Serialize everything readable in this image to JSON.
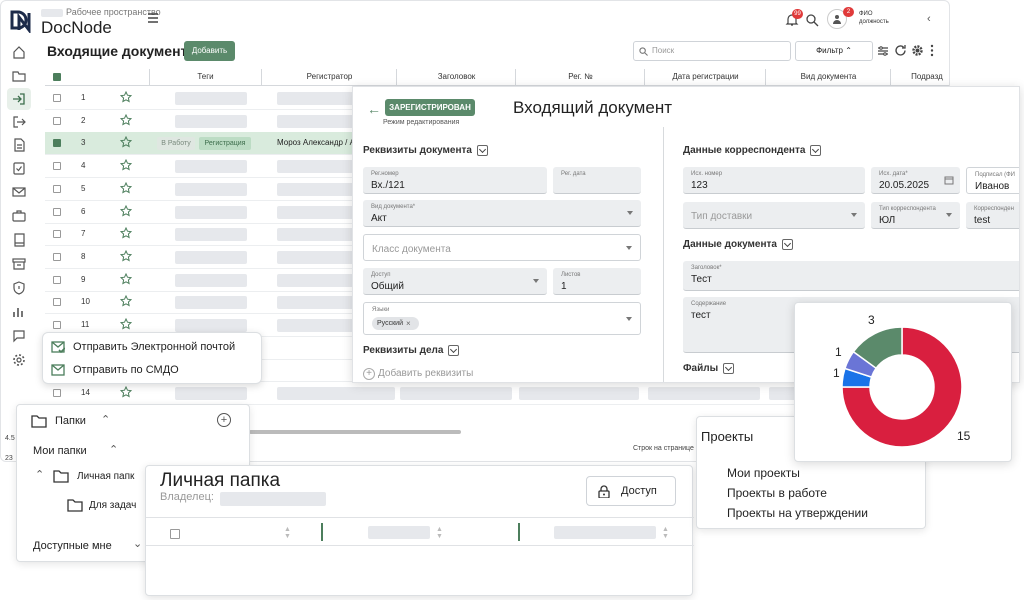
{
  "header": {
    "workspace_label": "Рабочее пространство",
    "brand": "DocNode",
    "bell_count": "99",
    "user_badge": "2",
    "user_name": "ФИО",
    "user_role": "должность"
  },
  "toolbar": {
    "title": "Входящие документы",
    "add_label": "Добавить",
    "search_placeholder": "Поиск",
    "filter_label": "Фильтр"
  },
  "table": {
    "columns": [
      "Теги",
      "Регистратор",
      "Заголовок",
      "Рег. №",
      "Дата регистрации",
      "Вид документа",
      "Подразд"
    ],
    "rows": [
      {
        "n": "1"
      },
      {
        "n": "2"
      },
      {
        "n": "3",
        "tag1": "В Работу",
        "tag2": "Регистрация",
        "registrar": "Мороз Александр / А"
      },
      {
        "n": "4"
      },
      {
        "n": "5"
      },
      {
        "n": "6"
      },
      {
        "n": "7"
      },
      {
        "n": "8"
      },
      {
        "n": "9"
      },
      {
        "n": "10"
      },
      {
        "n": "11"
      }
    ],
    "row_14": "14",
    "rows_per_page": "Строк на странице",
    "left_nums": [
      "4.5",
      "23"
    ]
  },
  "context_menu": {
    "email": "Отправить Электронной почтой",
    "smdo": "Отправить по СМДО"
  },
  "document": {
    "status": "ЗАРЕГИСТРИРОВАН",
    "mode": "Режим редактирования",
    "title": "Входящий документ",
    "left": {
      "section": "Реквизиты документа",
      "reg_number_label": "Рег.номер",
      "reg_number": "Вх./121",
      "reg_date_label": "Рег. дата",
      "doc_type_label": "Вид документа*",
      "doc_type": "Акт",
      "doc_class_placeholder": "Класс документа",
      "access_label": "Доступ",
      "access": "Общий",
      "sheets_label": "Листов",
      "sheets": "1",
      "langs_label": "Языки",
      "lang": "Русский",
      "case_section": "Реквизиты дела",
      "add_requisites": "Добавить реквизиты"
    },
    "right": {
      "section": "Данные корреспондента",
      "out_number_label": "Исх. номер",
      "out_number": "123",
      "out_date_label": "Исх. дата*",
      "out_date": "20.05.2025",
      "signed_label": "Подписал (ФИ",
      "signed": "Иванов",
      "delivery_placeholder": "Тип доставки",
      "corr_type_label": "Тип корреспондента",
      "corr_type": "ЮЛ",
      "corr_label": "Корреспонден",
      "corr": "test",
      "data_section": "Данные документа",
      "heading_label": "Заголовок*",
      "heading": "Тест",
      "content_label": "Содержание",
      "content": "тест",
      "files_section": "Файлы"
    }
  },
  "folders": {
    "title": "Папки",
    "my_folders": "Мои папки",
    "personal": "Личная папк",
    "tasks": "Для задач",
    "available": "Доступные мне"
  },
  "personal_folder": {
    "title": "Личная папка",
    "owner_label": "Владелец:",
    "access_btn": "Доступ"
  },
  "projects": {
    "title": "Проекты",
    "items": [
      "Мои проекты",
      "Проекты в работе",
      "Проекты на утверждении"
    ]
  },
  "chart_data": {
    "type": "pie",
    "donut": true,
    "values": [
      15,
      1,
      1,
      3
    ],
    "labels": [
      "15",
      "1",
      "1",
      "3"
    ],
    "colors": [
      "#d91f3f",
      "#1a73e8",
      "#6a75d6",
      "#5b8a6b"
    ]
  }
}
